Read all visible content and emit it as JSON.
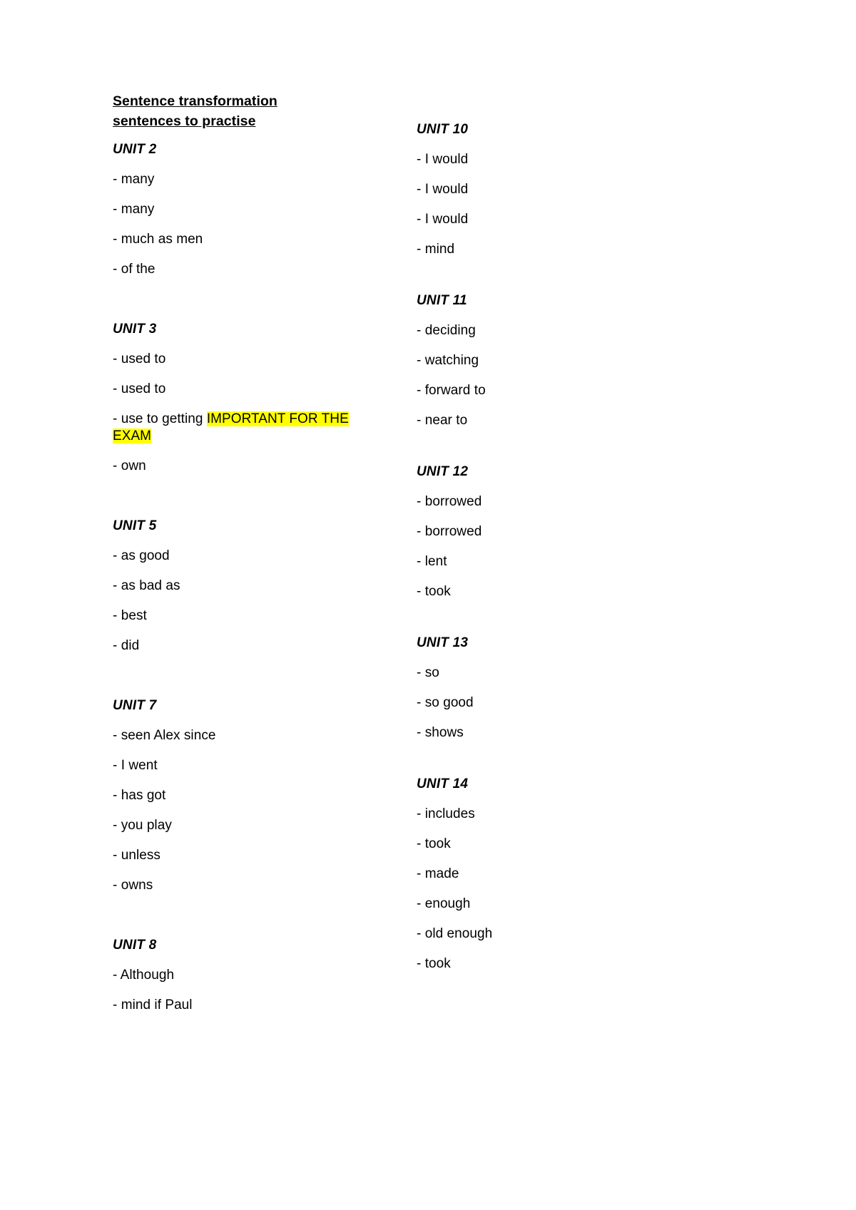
{
  "document": {
    "title": "Sentence transformation sentences to practise",
    "highlight_color": "#ffff00",
    "text_color": "#000000",
    "background_color": "#ffffff"
  },
  "columns": {
    "left": [
      {
        "heading": "UNIT 2",
        "items": [
          {
            "text": "- many"
          },
          {
            "text": "- many"
          },
          {
            "text": "- much as men"
          },
          {
            "text": "- of the"
          }
        ]
      },
      {
        "heading": "UNIT 3",
        "items": [
          {
            "text": "- used to"
          },
          {
            "text": "- used to"
          },
          {
            "text": "- use to getting ",
            "highlight": "IMPORTANT FOR THE EXAM"
          },
          {
            "text": "- own"
          }
        ]
      },
      {
        "heading": "UNIT 5",
        "items": [
          {
            "text": "- as good"
          },
          {
            "text": "- as bad as"
          },
          {
            "text": "- best"
          },
          {
            "text": "- did"
          }
        ]
      },
      {
        "heading": "UNIT 7",
        "items": [
          {
            "text": "- seen Alex since"
          },
          {
            "text": "- I went"
          },
          {
            "text": "- has got"
          },
          {
            "text": "- you play"
          },
          {
            "text": "- unless"
          },
          {
            "text": "- owns"
          }
        ]
      },
      {
        "heading": "UNIT 8",
        "items": [
          {
            "text": "- Although"
          },
          {
            "text": "- mind if Paul"
          }
        ]
      }
    ],
    "right": [
      {
        "heading": "UNIT 10",
        "items": [
          {
            "text": "- I would"
          },
          {
            "text": "- I would"
          },
          {
            "text": "- I would"
          },
          {
            "text": "- mind"
          }
        ]
      },
      {
        "heading": "UNIT 11",
        "items": [
          {
            "text": "- deciding"
          },
          {
            "text": "- watching"
          },
          {
            "text": "- forward to"
          },
          {
            "text": "- near to"
          }
        ]
      },
      {
        "heading": "UNIT 12",
        "items": [
          {
            "text": "- borrowed"
          },
          {
            "text": "- borrowed"
          },
          {
            "text": "- lent"
          },
          {
            "text": "- took"
          }
        ]
      },
      {
        "heading": "UNIT 13",
        "items": [
          {
            "text": "- so"
          },
          {
            "text": "- so good"
          },
          {
            "text": "- shows"
          }
        ]
      },
      {
        "heading": "UNIT 14",
        "items": [
          {
            "text": "- includes"
          },
          {
            "text": "- took"
          },
          {
            "text": "- made"
          },
          {
            "text": "- enough"
          },
          {
            "text": "- old enough"
          },
          {
            "text": "- took"
          }
        ]
      }
    ]
  }
}
